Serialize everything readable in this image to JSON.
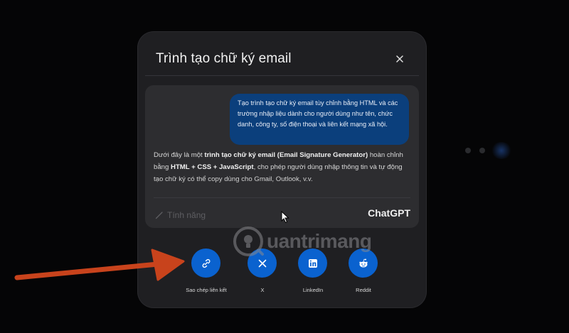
{
  "modal": {
    "title": "Trình tạo chữ ký email",
    "close_glyph": "×"
  },
  "preview": {
    "user_message": "Tạo trình tạo chữ ký email tùy chỉnh bằng HTML và các trường nhập liệu dành cho người dùng như tên, chức danh, công ty, số điện thoại và liên kết mạng xã hội.",
    "answer_intro": "Dưới đây là một ",
    "answer_bold1": "trình tạo chữ ký email (Email Signature Generator)",
    "answer_mid1": " hoàn chỉnh bằng ",
    "answer_bold2": "HTML + CSS + JavaScript",
    "answer_rest": ", cho phép người dùng nhập thông tin và tự động tạo chữ ký có thể copy dùng cho Gmail, Outlook, v.v.",
    "feature_label": "Tính năng",
    "brand_label": "ChatGPT"
  },
  "share": {
    "copy_link": "Sao chép liên kết",
    "x": "X",
    "linkedin": "LinkedIn",
    "reddit": "Reddit"
  },
  "watermark": {
    "text": "uantrimang"
  },
  "colors": {
    "accent": "#0a62cf",
    "arrow": "#c8431c",
    "bubble": "#0b3f7c"
  }
}
